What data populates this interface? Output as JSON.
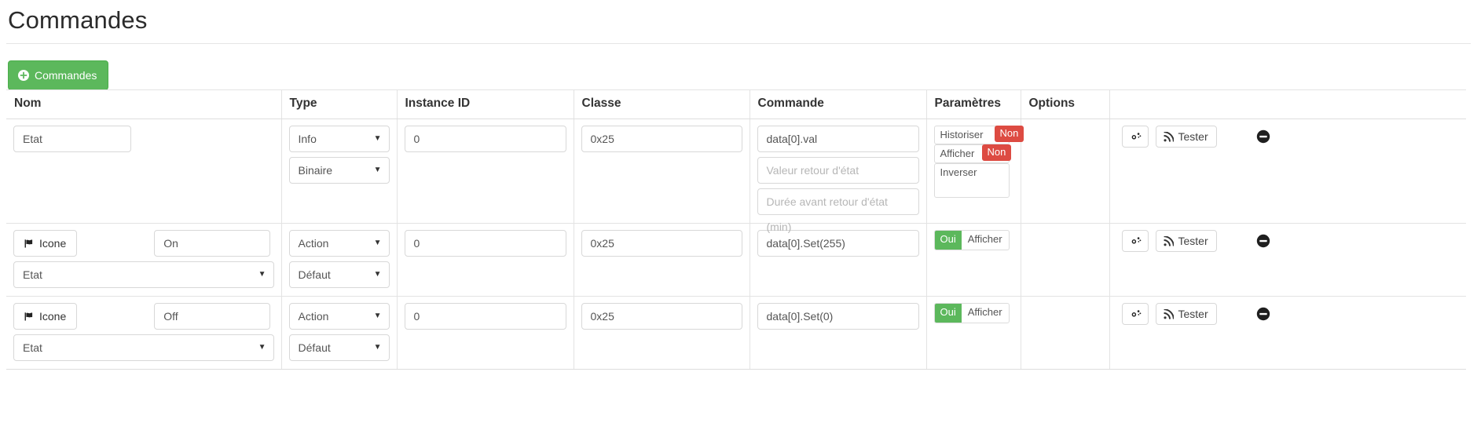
{
  "page": {
    "title": "Commandes"
  },
  "toolbar": {
    "add_button_label": "Commandes",
    "add_button_icon": "plus-circle-icon",
    "accent_green": "#5cb85c"
  },
  "table": {
    "columns": [
      "Nom",
      "Type",
      "Instance ID",
      "Classe",
      "Commande",
      "Paramètres",
      "Options",
      ""
    ],
    "rows": [
      {
        "nom": {
          "mode": "input",
          "value": "Etat"
        },
        "type": {
          "primary": "Info",
          "secondary": "Binaire"
        },
        "instance_id": "0",
        "classe": "0x25",
        "commande": {
          "value": "data[0].val",
          "retour_placeholder": "Valeur retour d'état",
          "duree_placeholder": "Durée avant retour d'état (min)"
        },
        "parametres": {
          "kind": "list",
          "items": [
            {
              "label": "Historiser",
              "badge": "Non",
              "badge_color": "#dd4b42"
            },
            {
              "label": "Afficher",
              "badge": "Non",
              "badge_color": "#dd4b42"
            },
            {
              "label": "Inverser",
              "badge": "",
              "badge_color": ""
            }
          ]
        },
        "options": "",
        "actions": {
          "config_icon": "gears-icon",
          "test_label": "Tester",
          "test_icon": "rss-signal-icon",
          "remove_icon": "minus-circle-icon"
        }
      },
      {
        "nom": {
          "mode": "icone",
          "icone_label": "Icone",
          "icone_glyph": "flag-icon",
          "name_value": "On",
          "select_value": "Etat"
        },
        "type": {
          "primary": "Action",
          "secondary": "Défaut"
        },
        "instance_id": "0",
        "classe": "0x25",
        "commande": {
          "value": "data[0].Set(255)"
        },
        "parametres": {
          "kind": "pill",
          "pill_yes": "Oui",
          "pill_label": "Afficher",
          "pill_color": "#5cb85c"
        },
        "options": "",
        "actions": {
          "config_icon": "gears-icon",
          "test_label": "Tester",
          "test_icon": "rss-signal-icon",
          "remove_icon": "minus-circle-icon"
        }
      },
      {
        "nom": {
          "mode": "icone",
          "icone_label": "Icone",
          "icone_glyph": "flag-icon",
          "name_value": "Off",
          "select_value": "Etat"
        },
        "type": {
          "primary": "Action",
          "secondary": "Défaut"
        },
        "instance_id": "0",
        "classe": "0x25",
        "commande": {
          "value": "data[0].Set(0)"
        },
        "parametres": {
          "kind": "pill",
          "pill_yes": "Oui",
          "pill_label": "Afficher",
          "pill_color": "#5cb85c"
        },
        "options": "",
        "actions": {
          "config_icon": "gears-icon",
          "test_label": "Tester",
          "test_icon": "rss-signal-icon",
          "remove_icon": "minus-circle-icon"
        }
      }
    ]
  }
}
